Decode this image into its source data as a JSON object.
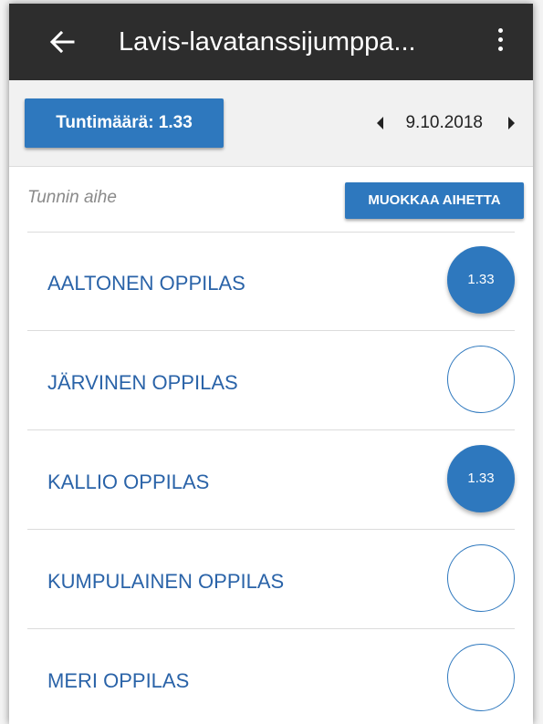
{
  "appbar": {
    "title": "Lavis-lavatanssijumppa..."
  },
  "toolbar": {
    "hours_label": "Tuntimäärä: 1.33",
    "date": "9.10.2018"
  },
  "topic": {
    "placeholder": "Tunnin aihe",
    "edit_label": "MUOKKAA AIHETTA"
  },
  "students": [
    {
      "name": "AALTONEN OPPILAS",
      "hours": "1.33"
    },
    {
      "name": "JÄRVINEN OPPILAS",
      "hours": ""
    },
    {
      "name": "KALLIO OPPILAS",
      "hours": "1.33"
    },
    {
      "name": "KUMPULAINEN OPPILAS",
      "hours": ""
    },
    {
      "name": "MERI OPPILAS",
      "hours": ""
    }
  ],
  "colors": {
    "accent": "#2e78be",
    "appbar": "#2d2d2d",
    "name_text": "#2a63a8"
  },
  "icons": {
    "back": "arrow-left-icon",
    "more": "more-vertical-icon",
    "prev": "caret-left-icon",
    "next": "caret-right-icon"
  }
}
